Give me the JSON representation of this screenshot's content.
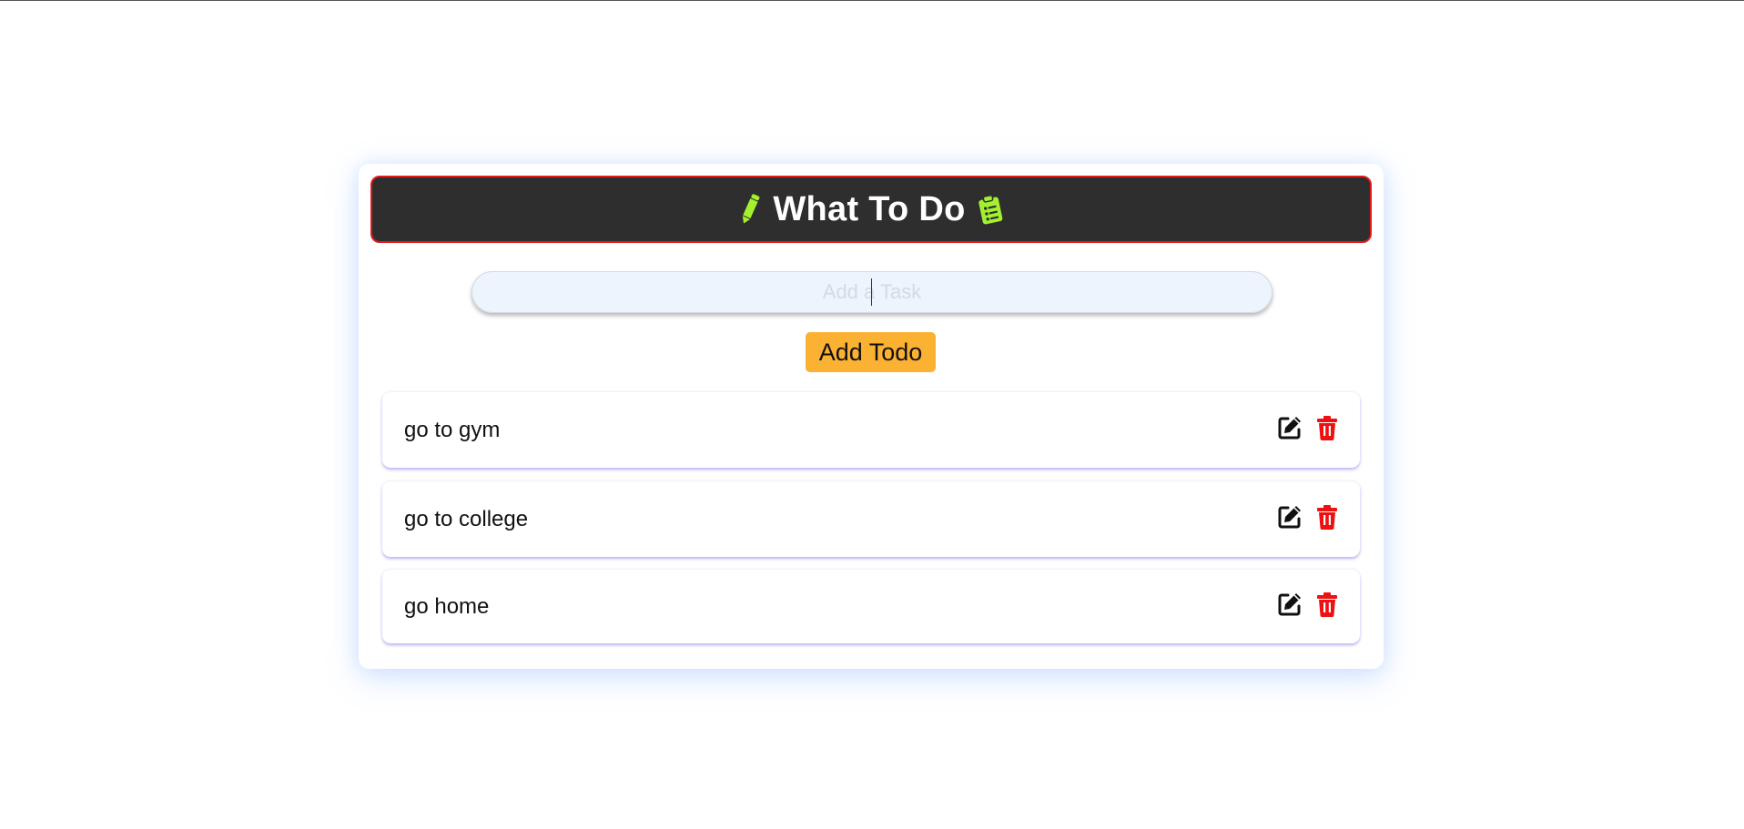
{
  "header": {
    "title": "What To Do",
    "left_icon": "pencil-icon",
    "right_icon": "clipboard-list-icon",
    "icon_color": "#a3f02f",
    "background_color": "#2e2e2e",
    "border_color": "#e11b1b"
  },
  "input": {
    "placeholder": "Add a Task",
    "value": ""
  },
  "add_button": {
    "label": "Add Todo",
    "color": "#fbb132"
  },
  "todos": [
    {
      "text": "go to gym",
      "edit_icon": "edit-icon",
      "delete_icon": "trash-icon"
    },
    {
      "text": "go to college",
      "edit_icon": "edit-icon",
      "delete_icon": "trash-icon"
    },
    {
      "text": "go home",
      "edit_icon": "edit-icon",
      "delete_icon": "trash-icon"
    }
  ],
  "colors": {
    "delete": "#ee1111",
    "edit": "#111111"
  }
}
